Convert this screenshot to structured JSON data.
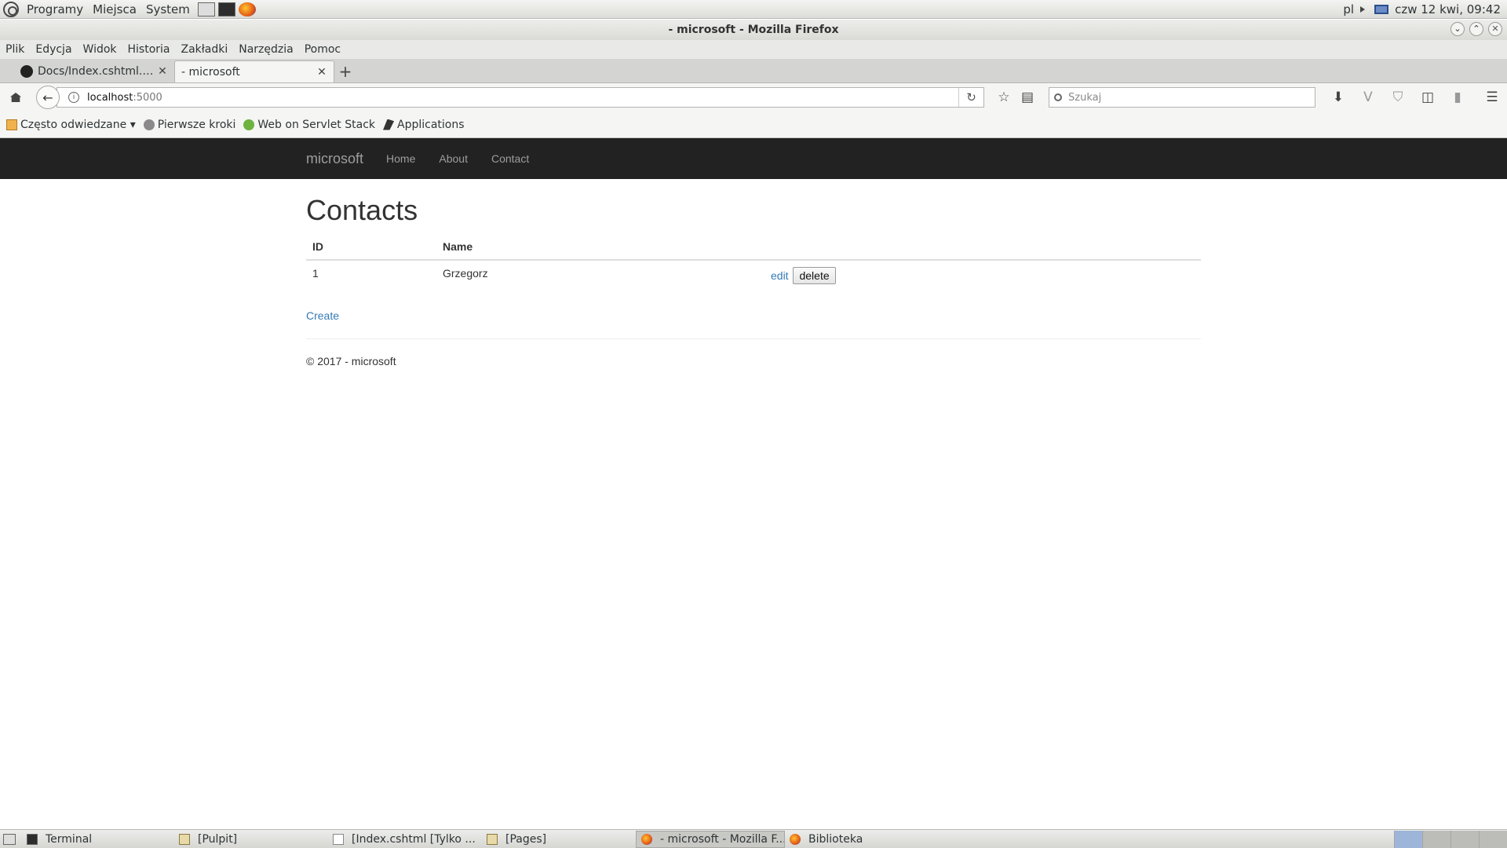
{
  "system_panel": {
    "menus": [
      "Programy",
      "Miejsca",
      "System"
    ],
    "keyboard_layout": "pl",
    "clock": "czw 12 kwi, 09:42"
  },
  "window": {
    "title": "- microsoft - Mozilla Firefox"
  },
  "firefox_menu": [
    "Plik",
    "Edycja",
    "Widok",
    "Historia",
    "Zakładki",
    "Narzędzia",
    "Pomoc"
  ],
  "tabs": [
    {
      "label": "Docs/Index.cshtml.cs...",
      "icon": "github-icon",
      "active": false
    },
    {
      "label": "- microsoft",
      "icon": "page-icon",
      "active": true
    }
  ],
  "address_bar": {
    "host": "localhost",
    "port": ":5000"
  },
  "search_bar": {
    "placeholder": "Szukaj"
  },
  "bookmarks": [
    {
      "label": "Często odwiedzane ▾",
      "icon": "folder-icon"
    },
    {
      "label": "Pierwsze kroki",
      "icon": "globe-icon"
    },
    {
      "label": "Web on Servlet Stack",
      "icon": "spring-icon"
    },
    {
      "label": "Applications",
      "icon": "app-icon"
    }
  ],
  "site": {
    "brand": "microsoft",
    "nav": [
      "Home",
      "About",
      "Contact"
    ],
    "heading": "Contacts",
    "table": {
      "columns": [
        "ID",
        "Name"
      ],
      "rows": [
        {
          "id": "1",
          "name": "Grzegorz",
          "edit_label": "edit",
          "delete_label": "delete"
        }
      ]
    },
    "create_label": "Create",
    "footer": "© 2017 - microsoft"
  },
  "taskbar": [
    {
      "label": "Terminal",
      "icon": "terminal-icon",
      "active": false
    },
    {
      "label": "[Pulpit]",
      "icon": "folder-icon",
      "active": false
    },
    {
      "label": "[Index.cshtml [Tylko ...",
      "icon": "editor-icon",
      "active": false
    },
    {
      "label": "[Pages]",
      "icon": "folder-icon",
      "active": false
    },
    {
      "label": "- microsoft - Mozilla F...",
      "icon": "firefox-icon",
      "active": true
    },
    {
      "label": "Biblioteka",
      "icon": "firefox-icon",
      "active": false
    }
  ]
}
